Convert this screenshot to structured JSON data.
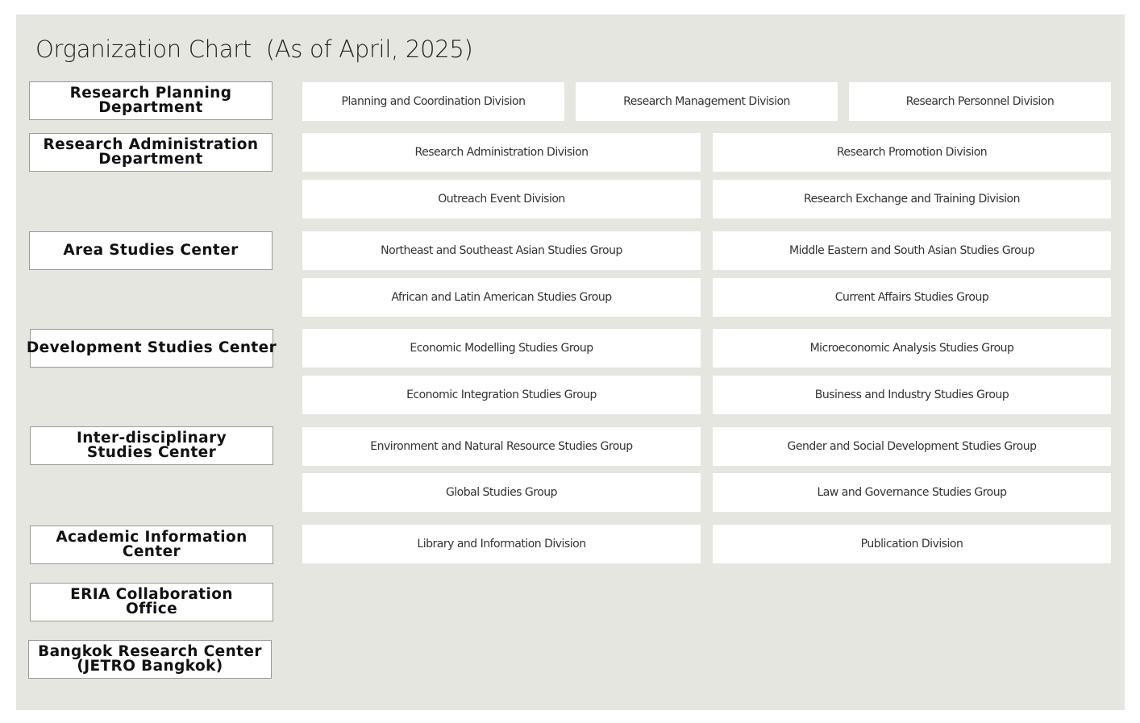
{
  "title": "Organization Chart  (As of April, 2025)",
  "departments": [
    "Research Planning\nDepartment",
    "Research Administration\nDepartment",
    "Area Studies Center",
    "Development Studies Center",
    "Inter-disciplinary\nStudies Center",
    "Academic Information\nCenter",
    "ERIA Collaboration\nOffice",
    "Bangkok Research Center\n(JETRO Bangkok)"
  ],
  "divisions": [
    "Planning and Coordination Division",
    "Research Management Division",
    "Research Personnel Division",
    "Research Administration Division",
    "Research Promotion Division",
    "Outreach Event Division",
    "Research Exchange and Training Division",
    "Northeast and Southeast Asian Studies Group",
    "Middle Eastern and South Asian Studies Group",
    "African and Latin American Studies Group",
    "Current Affairs Studies Group",
    "Economic Modelling Studies Group",
    "Microeconomic Analysis Studies Group",
    "Economic Integration Studies Group",
    "Business and Industry Studies Group",
    "Environment and Natural Resource Studies Group",
    "Gender and Social Development Studies Group",
    "Global Studies Group",
    "Law and Governance Studies Group",
    "Library and Information Division",
    "Publication Division"
  ]
}
